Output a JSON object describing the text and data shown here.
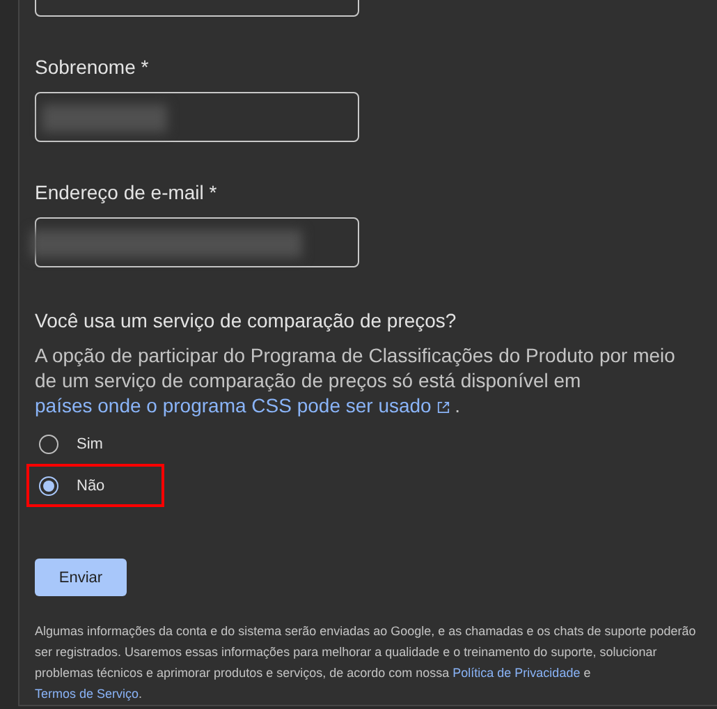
{
  "fields": [
    {
      "label": "Sobrenome *",
      "blurred": true
    },
    {
      "label": "Endereço de e-mail *",
      "blurred": true
    }
  ],
  "question": {
    "title": "Você usa um serviço de comparação de preços?",
    "text_before": "A opção de participar do Programa de Classificações do Produto por meio de um serviço de comparação de preços só está disponível em",
    "link": "países onde o programa CSS pode ser usado",
    "text_after": "."
  },
  "options": [
    {
      "label": "Sim",
      "selected": false,
      "highlighted": false
    },
    {
      "label": "Não",
      "selected": true,
      "highlighted": true
    }
  ],
  "submit_button": "Enviar",
  "footer": {
    "text_before": "Algumas informações da conta e do sistema serão enviadas ao Google, e as chamadas e os chats de suporte poderão ser registrados. Usaremos essas informações para melhorar a qualidade e o treinamento do suporte, solucionar problemas técnicos e aprimorar produtos e serviços, de acordo com nossa",
    "link_1": "Política de Privacidade",
    "joiner": "e",
    "link_2": "Termos de Serviço",
    "text_after": "."
  }
}
